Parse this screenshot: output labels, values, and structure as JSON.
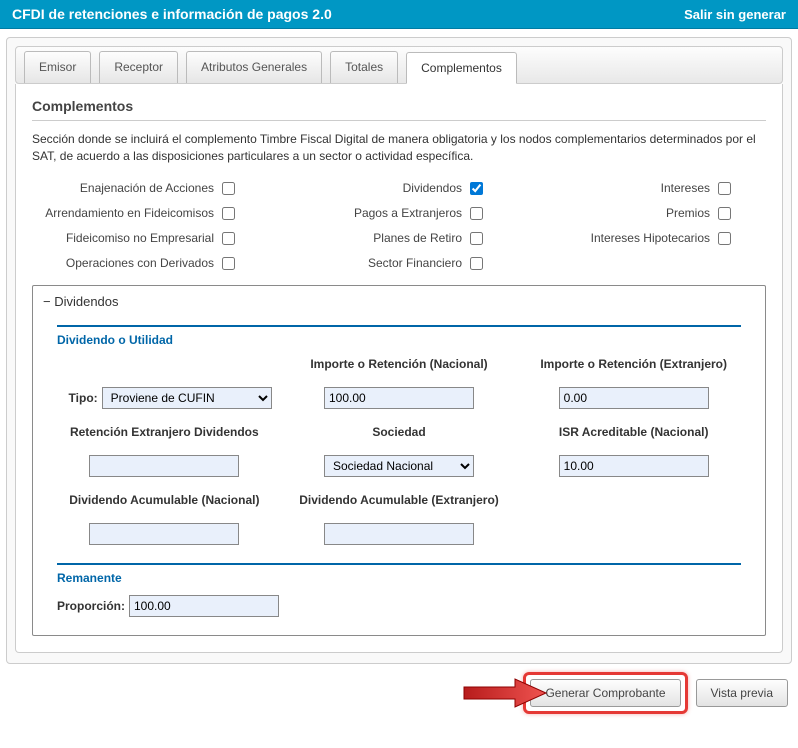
{
  "header": {
    "title": "CFDI de retenciones e información de pagos 2.0",
    "exit": "Salir sin generar"
  },
  "tabs": {
    "emisor": "Emisor",
    "receptor": "Receptor",
    "atributos": "Atributos Generales",
    "totales": "Totales",
    "complementos": "Complementos"
  },
  "section": {
    "title": "Complementos",
    "desc": "Sección donde se incluirá el complemento Timbre Fiscal Digital de manera obligatoria y los nodos complementarios determinados por el SAT, de acuerdo a las disposiciones particulares a un sector o actividad específica."
  },
  "checks": {
    "enajenacion": "Enajenación de Acciones",
    "dividendos": "Dividendos",
    "intereses": "Intereses",
    "arrendamiento": "Arrendamiento en Fideicomisos",
    "pagos_ext": "Pagos a Extranjeros",
    "premios": "Premios",
    "fideicomiso_no": "Fideicomiso no Empresarial",
    "planes": "Planes de Retiro",
    "int_hip": "Intereses Hipotecarios",
    "derivados": "Operaciones con Derivados",
    "sector": "Sector Financiero"
  },
  "accordion": {
    "title": "− Dividendos",
    "sub1": "Dividendo o Utilidad",
    "sub2": "Remanente"
  },
  "labels": {
    "tipo": "Tipo:",
    "imp_nac": "Importe o Retención (Nacional)",
    "imp_ext": "Importe o Retención (Extranjero)",
    "ret_ext_div": "Retención Extranjero Dividendos",
    "sociedad": "Sociedad",
    "isr_nac": "ISR Acreditable (Nacional)",
    "div_acum_nac": "Dividendo Acumulable (Nacional)",
    "div_acum_ext": "Dividendo Acumulable (Extranjero)",
    "proporcion": "Proporción:"
  },
  "values": {
    "tipo_sel": "Proviene de CUFIN",
    "imp_nac": "100.00",
    "imp_ext": "0.00",
    "ret_ext_div": "",
    "sociedad_sel": "Sociedad Nacional",
    "isr_nac": "10.00",
    "div_acum_nac": "",
    "div_acum_ext": "",
    "proporcion": "100.00"
  },
  "buttons": {
    "generar": "Generar Comprobante",
    "vista": "Vista previa"
  }
}
